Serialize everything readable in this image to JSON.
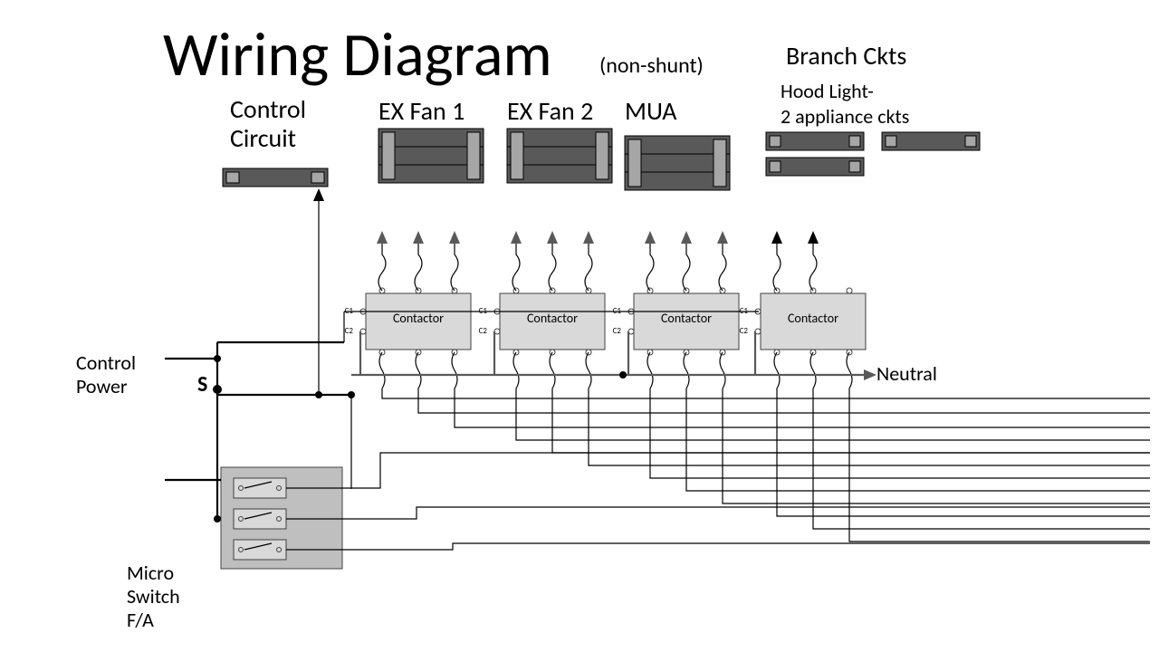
{
  "title": {
    "main": "Wiring Diagram",
    "sub": "(non-shunt)"
  },
  "labels": {
    "control_circuit": "Control\nCircuit",
    "ex_fan_1": "EX Fan 1",
    "ex_fan_2": "EX Fan 2",
    "mua": "MUA",
    "branch_ckts": "Branch Ckts",
    "hood_light": "Hood Light-\n2 appliance ckts",
    "control_power": "Control\nPower",
    "neutral": "Neutral",
    "s": "S",
    "micro_switch": "Micro\nSwitch\nF/A",
    "contactor": "Contactor",
    "c1": "C1",
    "c2": "C2"
  }
}
